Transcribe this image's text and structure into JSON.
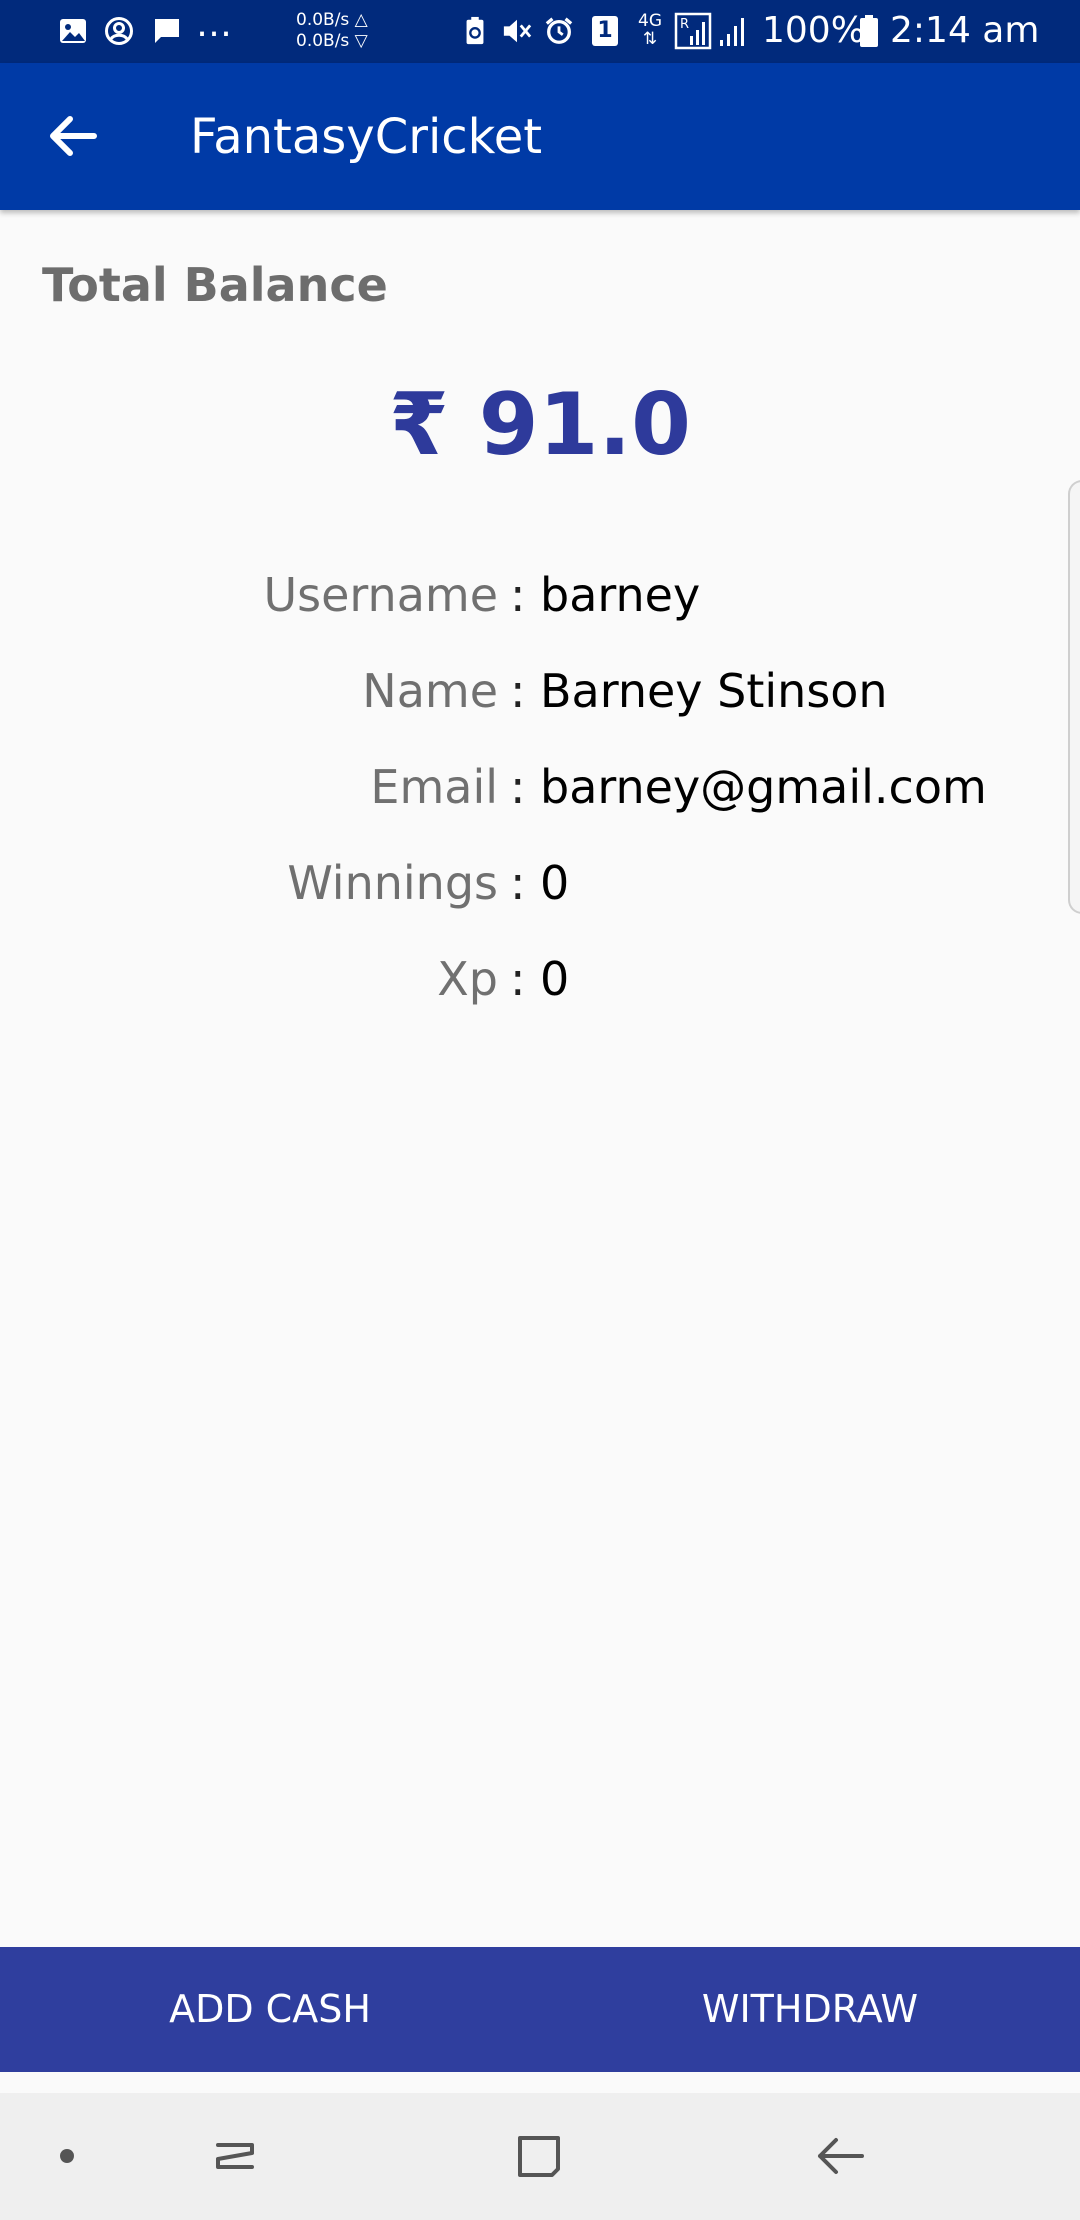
{
  "status_bar": {
    "net_up": "0.0B/s △",
    "net_down": "0.0B/s ▽",
    "overflow": "…",
    "sim_slot": "1",
    "network_type": "4G",
    "battery": "100%",
    "time": "2:14 am",
    "icons": [
      "gallery-icon",
      "account-circle-icon",
      "message-icon",
      "battery-saver-icon",
      "mute-icon",
      "alarm-icon",
      "sim-icon",
      "roaming-signal-icon",
      "signal-icon",
      "battery-icon"
    ]
  },
  "app_bar": {
    "title": "FantasyCricket",
    "back_icon": "back-arrow-icon"
  },
  "balance": {
    "label": "Total Balance",
    "amount": "₹ 91.0"
  },
  "profile": [
    {
      "label": "Username",
      "value": "barney"
    },
    {
      "label": "Name",
      "value": "Barney Stinson"
    },
    {
      "label": "Email",
      "value": "barney@gmail.com"
    },
    {
      "label": "Winnings",
      "value": "0"
    },
    {
      "label": "Xp",
      "value": "0"
    }
  ],
  "colon": ":",
  "actions": {
    "add_cash": "ADD CASH",
    "withdraw": "WITHDRAW"
  },
  "nav": [
    "dot-icon",
    "recents-icon",
    "home-icon",
    "back-icon"
  ],
  "colors": {
    "status_bar": "#012a7c",
    "app_bar": "#003aa6",
    "amount": "#2e3a9b",
    "action_bar": "#2f3e9e"
  }
}
